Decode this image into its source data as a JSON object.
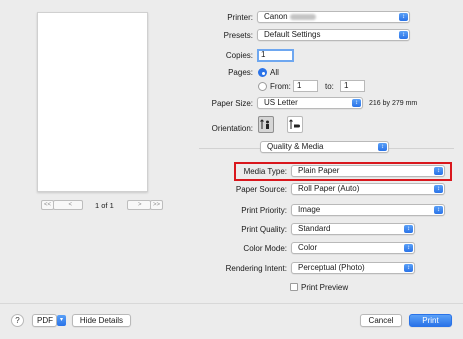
{
  "preview": {
    "nav_first": "<<",
    "nav_prev": "<",
    "page_indicator": "1 of 1",
    "nav_next": ">",
    "nav_last": ">>"
  },
  "printer": {
    "label": "Printer:",
    "value": "Canon"
  },
  "presets": {
    "label": "Presets:",
    "value": "Default Settings"
  },
  "copies": {
    "label": "Copies:",
    "value": "1"
  },
  "pages": {
    "label": "Pages:",
    "all_label": "All",
    "from_label": "From:",
    "from_value": "1",
    "to_label": "to:",
    "to_value": "1",
    "selected": "All"
  },
  "paper_size": {
    "label": "Paper Size:",
    "value": "US Letter",
    "dimensions": "216 by 279 mm"
  },
  "orientation": {
    "label": "Orientation:",
    "selected": "portrait"
  },
  "panel_selector": {
    "value": "Quality & Media"
  },
  "media_type": {
    "label": "Media Type:",
    "value": "Plain Paper"
  },
  "paper_source": {
    "label": "Paper Source:",
    "value": "Roll Paper (Auto)"
  },
  "print_priority": {
    "label": "Print Priority:",
    "value": "Image"
  },
  "print_quality": {
    "label": "Print Quality:",
    "value": "Standard"
  },
  "color_mode": {
    "label": "Color Mode:",
    "value": "Color"
  },
  "rendering_intent": {
    "label": "Rendering Intent:",
    "value": "Perceptual (Photo)"
  },
  "print_preview": {
    "label": "Print Preview",
    "checked": false
  },
  "footer": {
    "help": "?",
    "pdf": "PDF",
    "hide_details": "Hide Details",
    "cancel": "Cancel",
    "print": "Print"
  },
  "colors": {
    "accent": "#2a73e8",
    "highlight": "#d9171d",
    "background": "#ececec"
  }
}
